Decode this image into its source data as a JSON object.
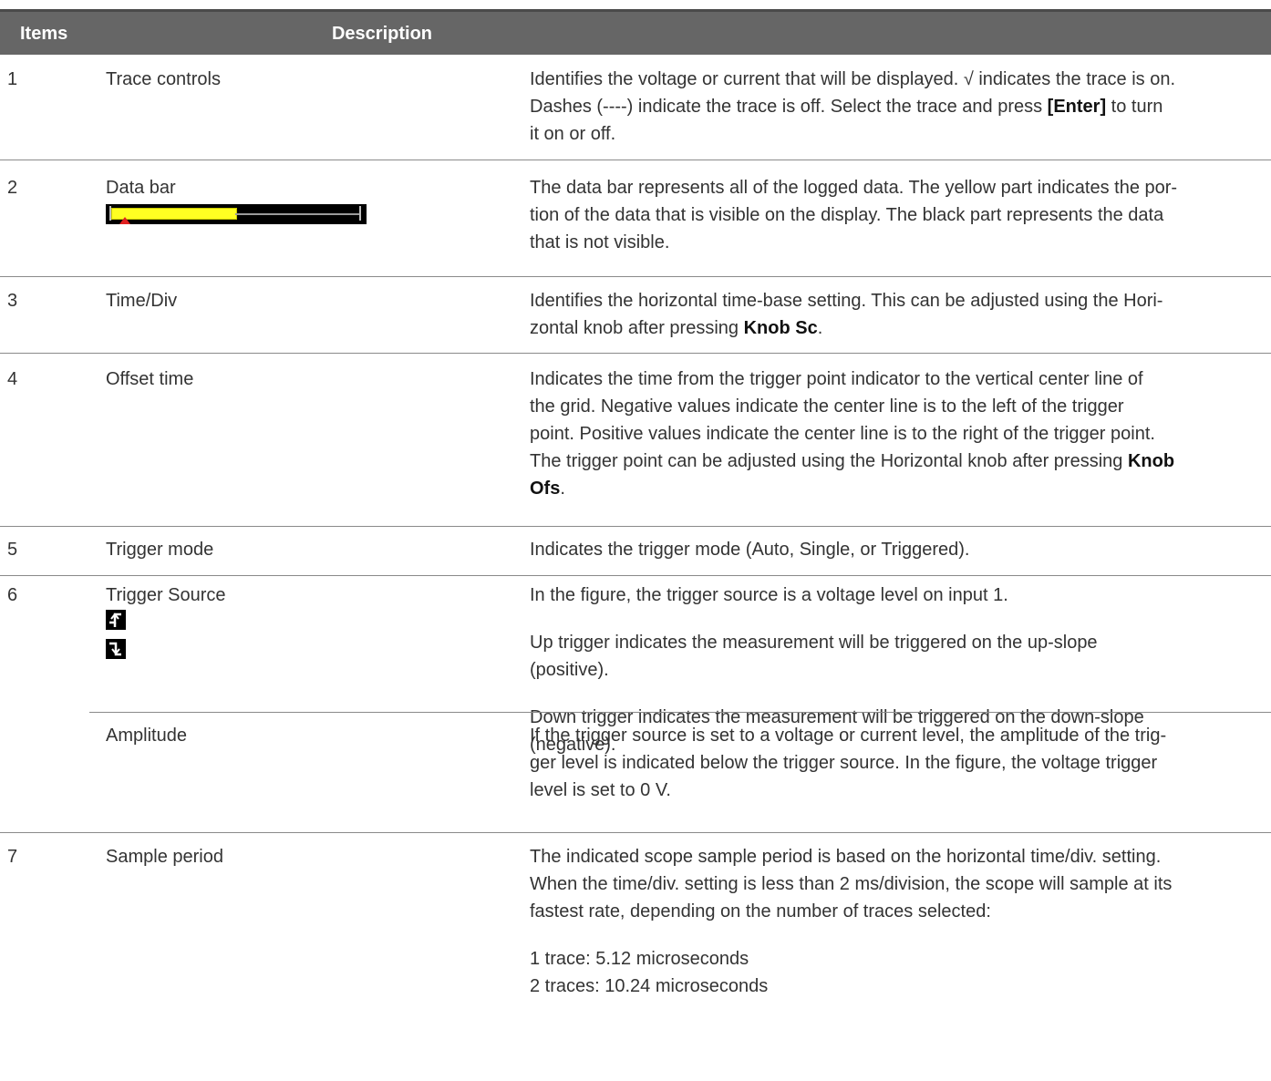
{
  "header": {
    "items": "Items",
    "description": "Description"
  },
  "rows": [
    {
      "num": "1",
      "item": "Trace controls",
      "desc_a": "Identifies the voltage or current that will be displayed. √ indicates the trace is on.",
      "desc_b": " Dashes (----) indicate the trace is off. Select the trace and press ",
      "desc_bold": "[Enter]",
      "desc_c": " to turn",
      "desc_d": "it on or off."
    },
    {
      "num": "2",
      "item": "Data bar",
      "data_bar_visible_fraction": 0.5,
      "desc_lines": [
        "The data bar represents all of the logged data. The yellow part indicates the por-",
        "tion of the data that is visible on the display. The black part represents the data",
        "that is not visible."
      ]
    },
    {
      "num": "3",
      "item": "Time/Div",
      "desc_a": "Identifies the horizontal time-base setting. This can be adjusted using the Hori-",
      "desc_b": "zontal knob after pressing ",
      "desc_bold": "Knob Sc",
      "desc_c": "."
    },
    {
      "num": "4",
      "item": "Offset time",
      "desc_lines": [
        "Indicates the time from the trigger point indicator to the vertical center line of",
        "the grid. Negative values indicate the center line is to the left of the trigger",
        "point. Positive values indicate the center line is to the right of the trigger point."
      ],
      "desc_d": "The trigger point can be adjusted using the Horizontal knob after pressing ",
      "desc_bold1": "Knob",
      "desc_bold2": "Ofs",
      "desc_e": "."
    },
    {
      "num": "5",
      "item": "Trigger mode",
      "desc": "Indicates the trigger mode (Auto, Single, or Triggered)."
    },
    {
      "num": "6",
      "item": "Trigger Source",
      "icons": [
        "up-trigger-icon",
        "down-trigger-icon"
      ],
      "desc_p1": "In the figure, the trigger source is a voltage level on input 1.",
      "desc_p2_l1": "Up trigger indicates the measurement will be triggered on the up-slope",
      "desc_p2_l2": "(positive).",
      "desc_p3_l1": "Down trigger indicates the measurement will be triggered on the down-slope",
      "desc_p3_l2": "(negative)."
    },
    {
      "num": "",
      "item": "Amplitude",
      "desc_lines": [
        "If the trigger source is set to a voltage or current level, the amplitude of the trig-",
        "ger level is indicated below the trigger source. In the figure, the voltage trigger",
        "level is set to 0 V."
      ]
    },
    {
      "num": "7",
      "item": "Sample period",
      "desc_lines": [
        "The indicated scope sample period is based on the horizontal time/div. setting.",
        "When the time/div. setting is less than 2 ms/division, the scope will sample at its",
        "fastest rate, depending on the number of traces selected:"
      ],
      "desc_p2_l1": "1 trace: 5.12 microseconds",
      "desc_p2_l2": "2 traces: 10.24 microseconds"
    }
  ]
}
